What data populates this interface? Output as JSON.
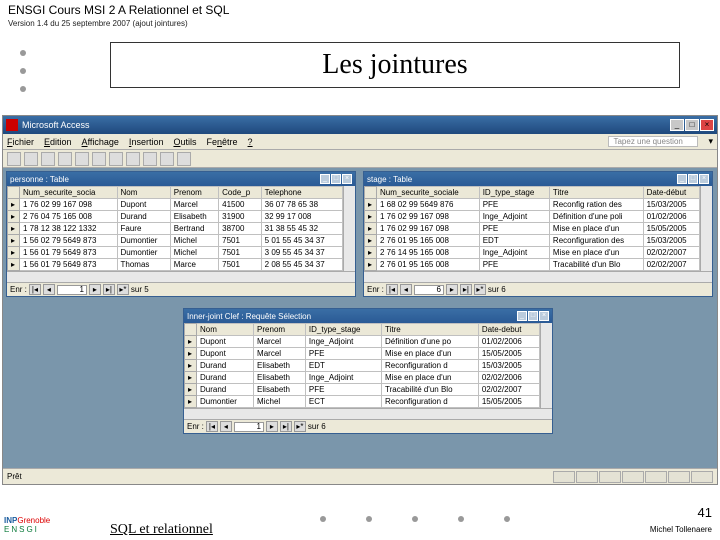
{
  "slide": {
    "header": "ENSGI Cours MSI 2 A Relationnel et SQL",
    "version": "Version 1.4 du 25 septembre 2007 (ajout jointures)",
    "title": "Les jointures",
    "page": "41",
    "footer_title": "SQL et relationnel",
    "author": "Michel Tollenaere",
    "logo": {
      "inp": "INP",
      "gre": "Grenoble",
      "ens": "ENSGI"
    }
  },
  "app": {
    "name": "Microsoft Access",
    "ask": "Tapez une question",
    "status": "Prêt",
    "menu": [
      "Fichier",
      "Edition",
      "Affichage",
      "Insertion",
      "Outils",
      "Fenêtre",
      "?"
    ]
  },
  "win_personne": {
    "title": "personne : Table",
    "cols": [
      "Num_securite_socia",
      "Nom",
      "Prenom",
      "Code_p",
      "Telephone"
    ],
    "rows": [
      [
        "1 76 02 99 167 098",
        "Dupont",
        "Marcel",
        "41500",
        "36 07 78 65 38"
      ],
      [
        "2 76 04 75 165 008",
        "Durand",
        "Elisabeth",
        "31900",
        "32 99 17 008"
      ],
      [
        "1 78 12 38 122 1332",
        "Faure",
        "Bertrand",
        "38700",
        "31 38 55 45 32"
      ],
      [
        "1 56 02 79 5649 873",
        "Dumontier",
        "Michel",
        "7501",
        "5 01 55 45 34 37"
      ],
      [
        "1 56 01 79 5649 873",
        "Dumontier",
        "Michel",
        "7501",
        "3 09 55 45 34 37"
      ],
      [
        "1 56 01 79 5649 873",
        "Thomas",
        "Marce",
        "7501",
        "2 08 55 45 34 37"
      ]
    ],
    "nav": {
      "label": "Enr :",
      "pos": "1",
      "total": "sur 5"
    }
  },
  "win_stage": {
    "title": "stage : Table",
    "cols": [
      "Num_securite_sociale",
      "ID_type_stage",
      "Titre",
      "Date-début"
    ],
    "rows": [
      [
        "1 68 02 99 5649 876",
        "PFE",
        "Reconfig ration des",
        "15/03/2005"
      ],
      [
        "1 76 02 99 167 098",
        "Inge_Adjoint",
        "Définition d'une poli",
        "01/02/2006"
      ],
      [
        "1 76 02 99 167 098",
        "PFE",
        "Mise en place d'un",
        "15/05/2005"
      ],
      [
        "2 76 01 95 165 008",
        "EDT",
        "Reconfiguration des",
        "15/03/2005"
      ],
      [
        "2 76 14 95 165 008",
        "Inge_Adjoint",
        "Mise en place d'un",
        "02/02/2007"
      ],
      [
        "2 76 01 95 165 008",
        "PFE",
        "Tracabilité d'un Blo",
        "02/02/2007"
      ]
    ],
    "nav": {
      "label": "Enr :",
      "pos": "6",
      "total": "sur 6"
    }
  },
  "win_join": {
    "title": "Inner-joint Clef : Requête Sélection",
    "cols": [
      "Nom",
      "Prenom",
      "ID_type_stage",
      "Titre",
      "Date-debut"
    ],
    "rows": [
      [
        "Dupont",
        "Marcel",
        "Inge_Adjoint",
        "Définition d'une po",
        "01/02/2006"
      ],
      [
        "Dupont",
        "Marcel",
        "PFE",
        "Mise en place d'un",
        "15/05/2005"
      ],
      [
        "Durand",
        "Elisabeth",
        "EDT",
        "Reconfiguration d",
        "15/03/2005"
      ],
      [
        "Durand",
        "Elisabeth",
        "Inge_Adjoint",
        "Mise en place d'un",
        "02/02/2006"
      ],
      [
        "Durand",
        "Elisabeth",
        "PFE",
        "Tracabilité d'un Blo",
        "02/02/2007"
      ],
      [
        "Dumontier",
        "Michel",
        "ECT",
        "Reconfiguration d",
        "15/05/2005"
      ]
    ],
    "nav": {
      "label": "Enr :",
      "pos": "1",
      "total": "sur 6"
    }
  }
}
